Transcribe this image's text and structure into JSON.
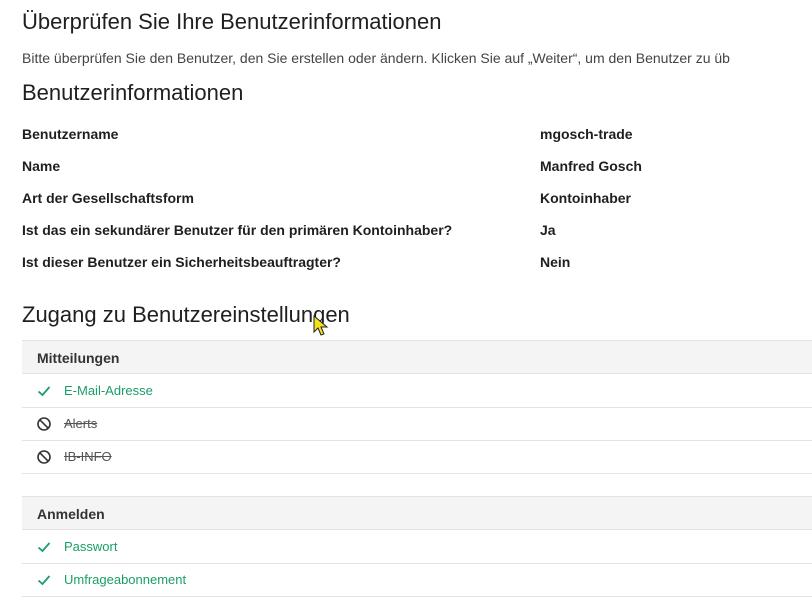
{
  "page": {
    "title": "Überprüfen Sie Ihre Benutzerinformationen",
    "description": "Bitte überprüfen Sie den Benutzer, den Sie erstellen oder ändern. Klicken Sie auf „Weiter“, um den Benutzer zu üb"
  },
  "user_info": {
    "heading": "Benutzerinformationen",
    "rows": [
      {
        "label": "Benutzername",
        "value": "mgosch-trade"
      },
      {
        "label": "Name",
        "value": "Manfred Gosch"
      },
      {
        "label": "Art der Gesellschaftsform",
        "value": "Kontoinhaber"
      },
      {
        "label": "Ist das ein sekundärer Benutzer für den primären Kontoinhaber?",
        "value": "Ja"
      },
      {
        "label": "Ist dieser Benutzer ein Sicherheitsbeauftragter?",
        "value": "Nein"
      }
    ]
  },
  "access": {
    "heading": "Zugang zu Benutzereinstellungen",
    "groups": [
      {
        "title": "Mitteilungen",
        "items": [
          {
            "label": "E-Mail-Adresse",
            "status": "allowed",
            "icon": "check-icon"
          },
          {
            "label": "Alerts",
            "status": "denied",
            "icon": "blocked-icon"
          },
          {
            "label": "IB-INFO",
            "status": "denied",
            "icon": "blocked-icon"
          }
        ]
      },
      {
        "title": "Anmelden",
        "items": [
          {
            "label": "Passwort",
            "status": "allowed",
            "icon": "check-icon"
          },
          {
            "label": "Umfrageabonnement",
            "status": "allowed",
            "icon": "check-icon"
          }
        ]
      }
    ]
  },
  "colors": {
    "allowed": "#1a9e69",
    "denied": "#555555",
    "header_bg": "#f4f4f4",
    "border": "#e3e3e3"
  }
}
